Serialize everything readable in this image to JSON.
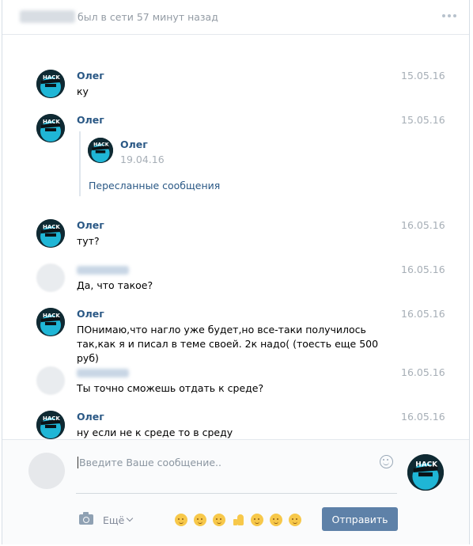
{
  "header": {
    "status": "был в сети 57 минут назад"
  },
  "messages": [
    {
      "author": "Олег",
      "date": "15.05.16",
      "text": "ку"
    },
    {
      "author": "Олег",
      "date": "15.05.16",
      "forward": {
        "author": "Олег",
        "date": "19.04.16",
        "link": "Пересланные сообщения"
      }
    },
    {
      "author": "Олег",
      "date": "16.05.16",
      "text": "тут?"
    },
    {
      "author": "",
      "date": "16.05.16",
      "text": "Да, что такое?"
    },
    {
      "author": "Олег",
      "date": "16.05.16",
      "text_lines": [
        "ПОнимаю,что нагло уже будет,но все-таки получилось",
        "так,как я и писал в теме своей. 2к надо( (тоесть еще 500 руб)"
      ]
    },
    {
      "author": "",
      "date": "16.05.16",
      "text": "Ты точно сможешь отдать к среде?"
    },
    {
      "author": "Олег",
      "date": "16.05.16",
      "text": "ну если не к среде то в среду"
    }
  ],
  "composer": {
    "placeholder": "Введите Ваше сообщение..",
    "more_label": "Ещё",
    "send_label": "Отправить",
    "emoji_icons": [
      "unamused-emoji-icon",
      "kissing-emoji-icon",
      "relieved-emoji-icon",
      "thumbs-up-icon",
      "confused-emoji-icon",
      "blush-emoji-icon",
      "relieved-emoji-icon"
    ]
  },
  "colors": {
    "accent": "#5e81a8",
    "link": "#2a5885",
    "muted": "#939ba4"
  }
}
